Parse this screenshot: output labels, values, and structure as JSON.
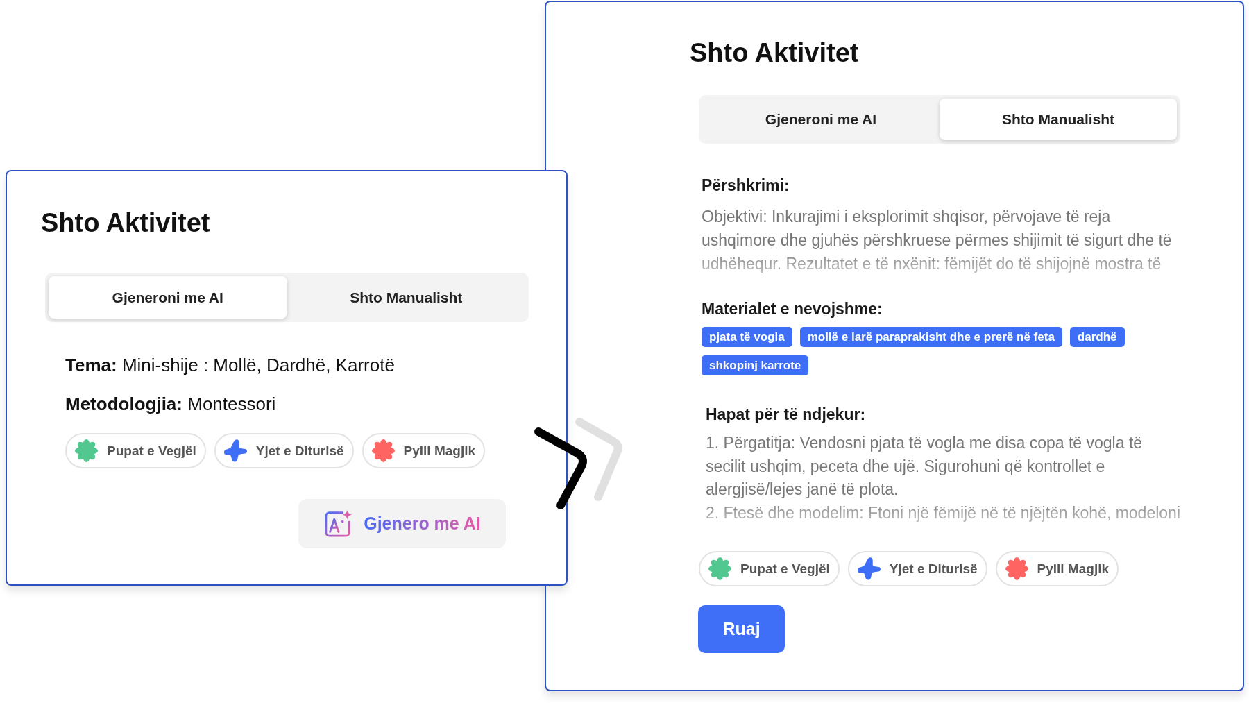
{
  "ai_form": {
    "title": "Shto Aktivitet",
    "tabs": [
      {
        "label": "Gjeneroni me AI",
        "selected": true
      },
      {
        "label": "Shto Manualisht",
        "selected": false
      }
    ],
    "fields": [
      {
        "label": "Tema:",
        "value": "Mini-shije : Mollë, Dardhë, Karrotë"
      },
      {
        "label": "Metodologjia:",
        "value": "Montessori"
      }
    ],
    "groups": [
      {
        "label": "Pupat e Vegjël",
        "kind": "flower",
        "color": "#52c78f"
      },
      {
        "label": "Yjet e Diturisë",
        "kind": "star",
        "color": "#3f6ef6"
      },
      {
        "label": "Pylli Magjik",
        "kind": "flower",
        "color": "#fe6461"
      }
    ],
    "generate_button": {
      "label": "Gjenero me AI"
    }
  },
  "manual_form": {
    "title": "Shto Aktivitet",
    "tabs": [
      {
        "label": "Gjeneroni me AI",
        "selected": false
      },
      {
        "label": "Shto Manualisht",
        "selected": true
      }
    ],
    "description": {
      "label": "Përshkrimi:",
      "text": "Objektivi: Inkurajimi i eksplorimit shqisor, përvojave të reja ushqimore dhe gjuhës përshkruese përmes shijimit të sigurt dhe të udhëhequr. Rezultatet e të nxënit: fëmijët do të shijojnë mostra të"
    },
    "materials": {
      "label": "Materialet e nevojshme:",
      "items": [
        "pjata të vogla",
        "mollë e larë paraprakisht dhe e prerë në feta",
        "dardhë",
        "shkopinj karrote"
      ]
    },
    "steps": {
      "label": "Hapat për të ndjekur:",
      "items": [
        "1. Përgatitja: Vendosni pjata të vogla me disa copa të vogla të secilit ushqim, peceta dhe ujë. Sigurohuni që kontrollet e alergjisë/lejes janë të plota.",
        "2. Ftesë dhe modelim: Ftoni një fëmijë në të njëjtën kohë, modeloni"
      ]
    },
    "groups": [
      {
        "label": "Pupat e Vegjël",
        "kind": "flower",
        "color": "#52c78f"
      },
      {
        "label": "Yjet e Diturisë",
        "kind": "star",
        "color": "#3f6ef6"
      },
      {
        "label": "Pylli Magjik",
        "kind": "flower",
        "color": "#fe6461"
      }
    ],
    "save_button": {
      "label": "Ruaj"
    }
  }
}
